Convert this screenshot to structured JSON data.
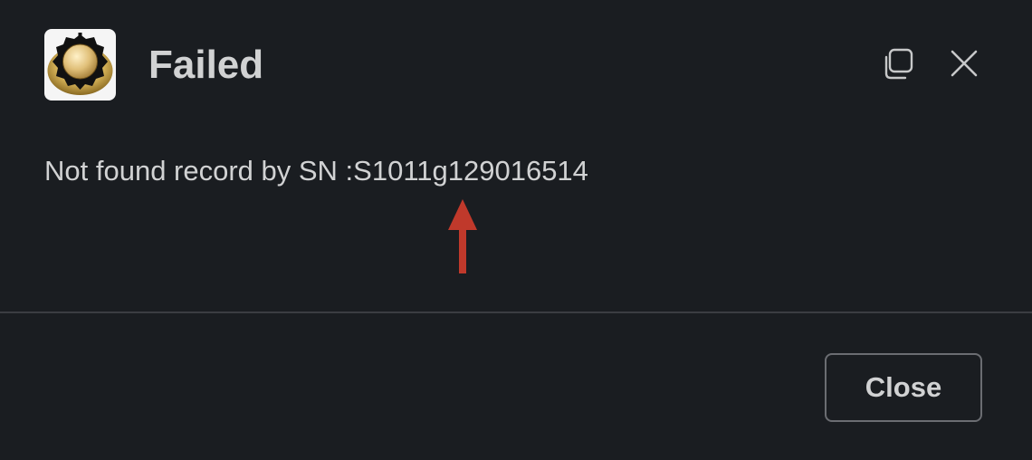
{
  "dialog": {
    "title": "Failed",
    "message": "Not found record by SN :S1011g129016514",
    "close_label": "Close",
    "icons": {
      "app": "gold-knob-app-icon",
      "copy": "copy-icon",
      "close": "close-icon",
      "annotation": "red-arrow-annotation"
    }
  },
  "colors": {
    "background": "#1a1d21",
    "text": "#d1d2d3",
    "divider": "#3b3d42",
    "button_border": "#6b6d72",
    "arrow": "#c0392b"
  }
}
